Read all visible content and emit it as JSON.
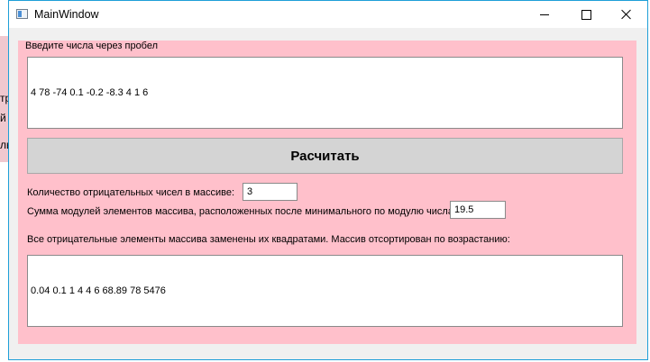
{
  "window": {
    "title": "MainWindow",
    "minimize_label": "",
    "maximize_label": "",
    "close_label": ""
  },
  "background_window": {
    "fragments": [
      "тр",
      "й",
      "ль"
    ]
  },
  "input": {
    "label": "Введите числа через пробел",
    "value": "4 78 -74 0.1 -0.2 -8.3 4 1 6"
  },
  "calculate_button": {
    "label": "Расчитать"
  },
  "negatives_count": {
    "label": "Количество отрицательных чисел в массиве:",
    "value": "3"
  },
  "abs_sum": {
    "label": "Сумма модулей элементов массива, расположенных после минимального по модулю числа:",
    "value": "19.5"
  },
  "result": {
    "label": "Все отрицательные элементы массива заменены их квадратами. Массив отсортирован по возрастанию:",
    "value": "0.04 0.1 1 4 4 6 68.89 78 5476"
  }
}
